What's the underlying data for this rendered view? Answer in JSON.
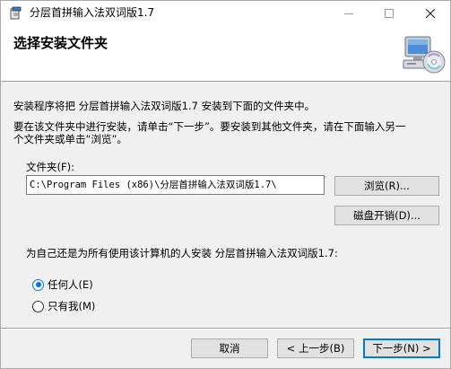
{
  "window": {
    "title": "分层首拼输入法双词版1.7",
    "icon": "installer-icon",
    "controls": {
      "minimize": "—",
      "maximize": "☐",
      "close": "✕"
    }
  },
  "header": {
    "title": "选择安装文件夹",
    "art_icon": "computer-cd-icon"
  },
  "body": {
    "line1": "安装程序将把 分层首拼输入法双词版1.7 安装到下面的文件夹中。",
    "line2": "要在该文件夹中进行安装，请单击“下一步”。要安装到其他文件夹，请在下面输入另一",
    "line3": "个文件夹或单击“浏览”。"
  },
  "folder": {
    "label": "文件夹(F):",
    "value": "C:\\Program Files (x86)\\分层首拼输入法双词版1.7\\",
    "browse_label": "浏览(R)...",
    "disk_cost_label": "磁盘开销(D)..."
  },
  "install_for": {
    "question": "为自己还是为所有使用该计算机的人安装 分层首拼输入法双词版1.7:",
    "options": [
      {
        "label": "任何人(E)",
        "checked": true
      },
      {
        "label": "只有我(M)",
        "checked": false
      }
    ]
  },
  "footer": {
    "cancel_label": "取消",
    "back_label": "< 上一步(B)",
    "next_label": "下一步(N) >"
  },
  "colors": {
    "accent": "#0078d7",
    "dialog_bg": "#f0f0f0",
    "header_bg": "#ffffff"
  }
}
